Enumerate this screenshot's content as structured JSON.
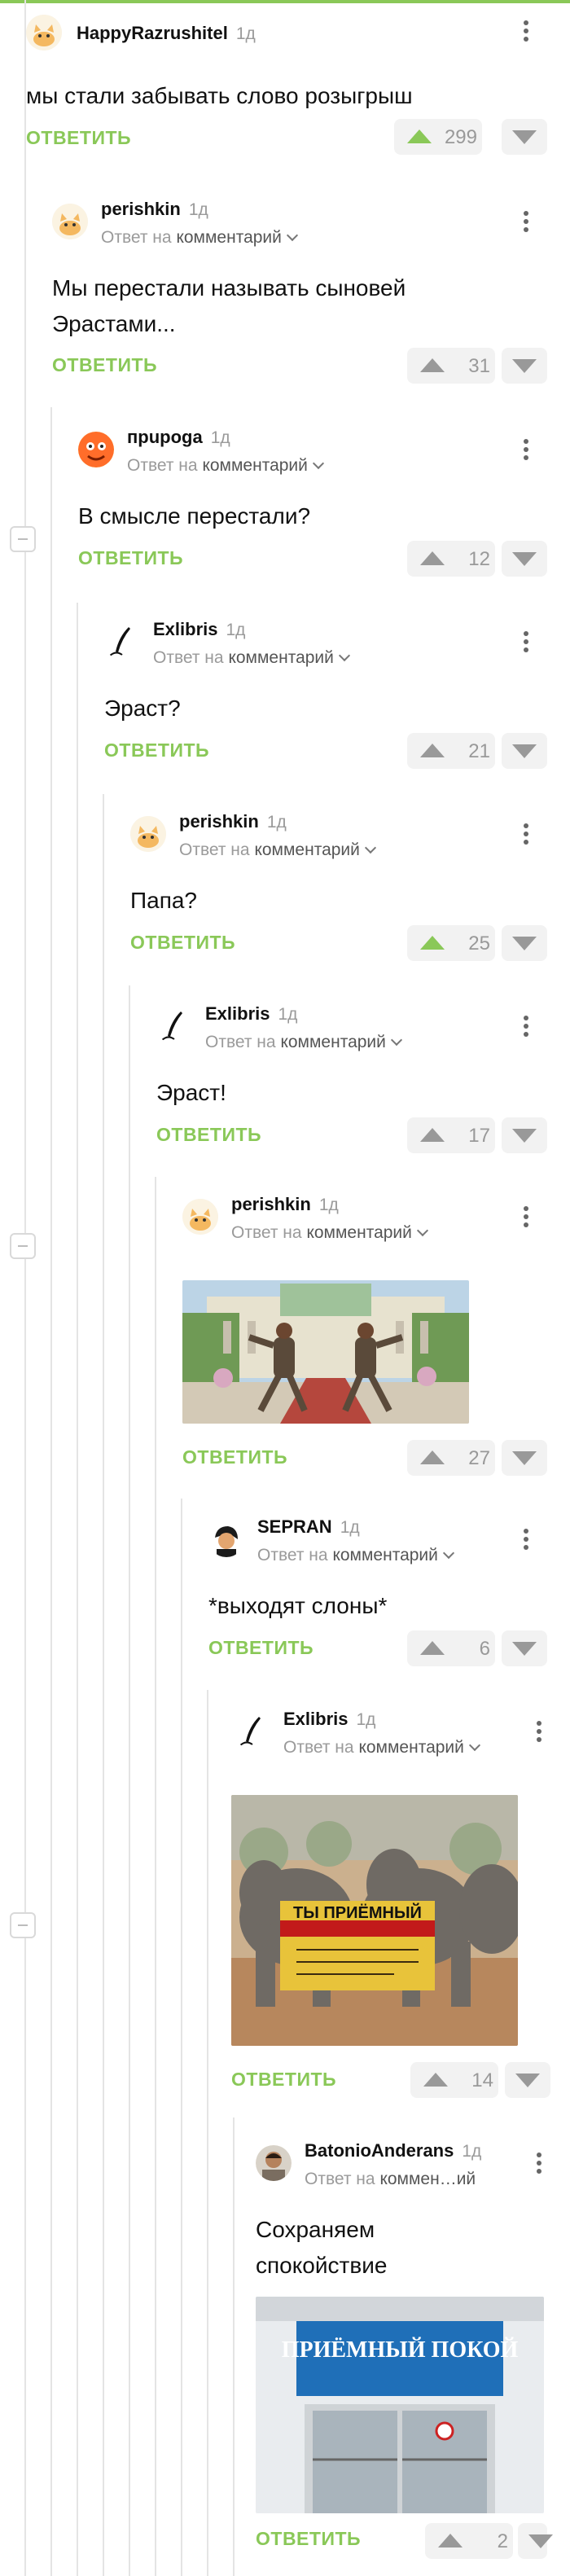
{
  "ui": {
    "reply_label": "ОТВЕТИТЬ",
    "reply_to_prefix": "Ответ на",
    "reply_to_target": "комментарий",
    "reply_to_target_short": "коммен…ий",
    "accent_color": "#8ac858"
  },
  "comments": [
    {
      "author": "HappyRazrushitel",
      "time": "1д",
      "text": "мы стали забывать слово розыгрыш",
      "votes": "299",
      "upvoted": true,
      "avatar_icon": "cat-avatar-icon"
    },
    {
      "author": "perishkin",
      "time": "1д",
      "text": "Мы перестали называть сыновей Эрастами...",
      "votes": "31",
      "upvoted": false,
      "avatar_icon": "cat-avatar-icon"
    },
    {
      "author": "прuроga",
      "time": "1д",
      "text": "В смысле перестали?",
      "votes": "12",
      "upvoted": false,
      "avatar_icon": "orange-face-avatar-icon"
    },
    {
      "author": "Exlibris",
      "time": "1д",
      "text": "Эраст?",
      "votes": "21",
      "upvoted": false,
      "avatar_icon": "quill-avatar-icon"
    },
    {
      "author": "perishkin",
      "time": "1д",
      "text": "Папа?",
      "votes": "25",
      "upvoted": true,
      "avatar_icon": "cat-avatar-icon"
    },
    {
      "author": "Exlibris",
      "time": "1д",
      "text": "Эраст!",
      "votes": "17",
      "upvoted": false,
      "avatar_icon": "quill-avatar-icon"
    },
    {
      "author": "perishkin",
      "time": "1д",
      "text": "",
      "votes": "27",
      "upvoted": false,
      "avatar_icon": "cat-avatar-icon",
      "image": "dancing-men-photo"
    },
    {
      "author": "SEPRAN",
      "time": "1д",
      "text": "*выходят слоны*",
      "votes": "6",
      "upvoted": false,
      "avatar_icon": "man-avatar-icon"
    },
    {
      "author": "Exlibris",
      "time": "1д",
      "text": "",
      "votes": "14",
      "upvoted": false,
      "avatar_icon": "quill-avatar-icon",
      "image": "elephants-photo",
      "image_sign": "ТЫ ПРИЁМНЫЙ"
    },
    {
      "author": "BatonioAnderans",
      "time": "1д",
      "text": "Сохраняем спокойствие",
      "votes": "2",
      "upvoted": false,
      "avatar_icon": "portrait-avatar-icon",
      "image": "hospital-entrance-photo",
      "image_sign": "ПРИЁМНЫЙ ПОКОЙ"
    }
  ]
}
